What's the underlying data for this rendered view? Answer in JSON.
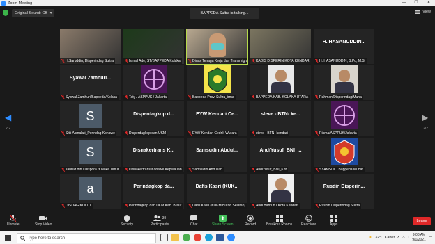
{
  "window": {
    "title": "Zoom Meeting",
    "min": "—",
    "max": "☐",
    "close": "✕"
  },
  "topbar": {
    "original_sound": "Original Sound: Off",
    "talking": "BAPPEDA Sultra is talking...",
    "view": "View"
  },
  "tiles": [
    {
      "row": 0,
      "col": 0,
      "kind": "photo",
      "color": "#8a7a6a",
      "label": "H.Saruddin, Disperindag Sultra"
    },
    {
      "row": 0,
      "col": 1,
      "kind": "photo",
      "color": "#1d3a1a",
      "label": "Ismail Ade, ST/BAPPEDA Kolaka"
    },
    {
      "row": 0,
      "col": 2,
      "kind": "photo",
      "color": "#b8a890",
      "label": "Dinas Tenaga Kerja dan Transmigrasi",
      "talk": true
    },
    {
      "row": 0,
      "col": 3,
      "kind": "photo",
      "color": "#7b7560",
      "label": "KADIS DISPERIN KOTA KENDARI"
    },
    {
      "row": 0,
      "col": 4,
      "kind": "text",
      "big": "H. HASANUDDIN...",
      "label": "H. HASANUDDIN, S.Pd, M.Si"
    },
    {
      "row": 1,
      "col": 0,
      "kind": "text",
      "big": "Syawal Zamhuri...",
      "label": "Syawal Zamhuri/Bappeda/Kolaka"
    },
    {
      "row": 1,
      "col": 1,
      "kind": "logo-purple",
      "label": "Taty / ASPPUK / Jakarta"
    },
    {
      "row": 1,
      "col": 2,
      "kind": "logo-yellow",
      "label": "Bappeda Prov. Sultra_irma"
    },
    {
      "row": 1,
      "col": 3,
      "kind": "photo-person",
      "color": "#e8e8e8",
      "label": "BAPPEDA KAB. KOLAKA UTARA"
    },
    {
      "row": 1,
      "col": 4,
      "kind": "photo-person",
      "color": "#d8d4cc",
      "label": "Rahman/Disperindag/Muna"
    },
    {
      "row": 2,
      "col": 0,
      "kind": "letter",
      "letter": "S",
      "label": "Sitti Asmalati_Perindag Konawe"
    },
    {
      "row": 2,
      "col": 1,
      "kind": "text",
      "big": "Disperdagkop d...",
      "label": "Disperdagkop dan UKM"
    },
    {
      "row": 2,
      "col": 2,
      "kind": "text",
      "big": "EYW Kendari Ce...",
      "label": "EYW Kendari Cedrik Wurara"
    },
    {
      "row": 2,
      "col": 3,
      "kind": "text",
      "big": "steve - BTN- ke...",
      "label": "steve - BTN- kendari"
    },
    {
      "row": 2,
      "col": 4,
      "kind": "logo-purple",
      "label": "Risma/ASPPUK/Jakarta"
    },
    {
      "row": 3,
      "col": 0,
      "kind": "letter",
      "letter": "S",
      "label": "sahrud din / Dispora /Kolaka Timur"
    },
    {
      "row": 3,
      "col": 1,
      "kind": "text",
      "big": "Disnakertrans K...",
      "label": "Disnakertrans Konawe Kepulauan"
    },
    {
      "row": 3,
      "col": 2,
      "kind": "text",
      "big": "Samsudin Abdul...",
      "label": "Samsudin Abdullah"
    },
    {
      "row": 3,
      "col": 3,
      "kind": "text",
      "big": "AndiYusuf_BNI_...",
      "label": "AndiYusuf_BNI_Kdr"
    },
    {
      "row": 3,
      "col": 4,
      "kind": "logo-blue",
      "label": "SYAMSUL / Bappeda Mubar"
    },
    {
      "row": 4,
      "col": 0,
      "kind": "letter",
      "letter": "a",
      "label": "DISDAG KOLUT"
    },
    {
      "row": 4,
      "col": 1,
      "kind": "text",
      "big": "Perindagkop da...",
      "label": "Perindagkop dan UKM Kab. Butur"
    },
    {
      "row": 4,
      "col": 2,
      "kind": "text",
      "big": "Dafis Kasri (KUK...",
      "label": "Dafis Kasri (KUKM Buton Selatan)"
    },
    {
      "row": 4,
      "col": 3,
      "kind": "photo-person",
      "color": "#efefef",
      "label": "Andi Bahrun / Kota Kendari"
    },
    {
      "row": 4,
      "col": 4,
      "kind": "text",
      "big": "Rusdin Disperin...",
      "label": "Rusdin Disperindag Sultra"
    }
  ],
  "nav": {
    "page": "2/2"
  },
  "toolbar": {
    "unmute": "Unmute",
    "stop_video": "Stop Video",
    "security": "Security",
    "participants": "Participants",
    "participants_count": "39",
    "chat": "Chat",
    "share_screen": "Share Screen",
    "record": "Record",
    "breakout": "Breakout Rooms",
    "reactions": "Reactions",
    "apps": "Apps",
    "leave": "Leave"
  },
  "taskbar": {
    "search": "Type here to search",
    "weather": "32°C  Kabut",
    "time": "9:08 AM",
    "date": "9/1/2021"
  },
  "colors": {
    "accent": "#2d8cff",
    "talk_border": "#b6d94c",
    "leave": "#e02828",
    "share": "#44c05a"
  }
}
